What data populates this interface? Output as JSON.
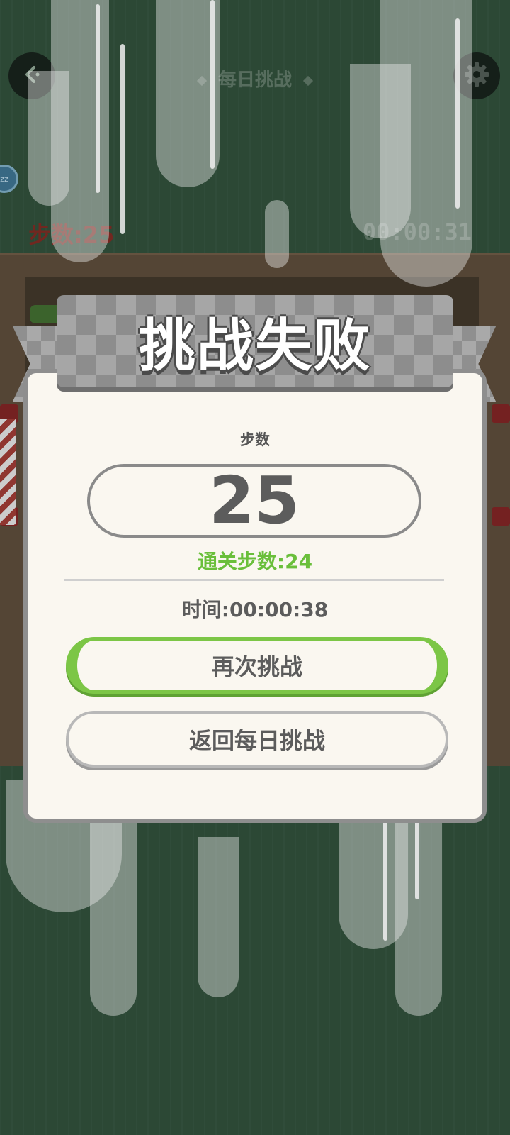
{
  "header": {
    "title": "每日挑战",
    "back_icon": "back-arrow-icon",
    "settings_icon": "gear-icon"
  },
  "hud": {
    "badge": "zz",
    "steps": "步数:25",
    "timer": "00:00:31"
  },
  "dialog": {
    "title": "挑战失败",
    "steps_caption": "步数",
    "steps_value": "25",
    "par_steps": "通关步数:24",
    "time": "时间:00:00:38",
    "retry_label": "再次挑战",
    "back_label": "返回每日挑战"
  },
  "colors": {
    "background": "#2f4d39",
    "accent_green": "#6abf3b",
    "ribbon": "#9a9a9a",
    "dialog_bg": "#faf7f0",
    "steps_red": "#7a2a22"
  }
}
